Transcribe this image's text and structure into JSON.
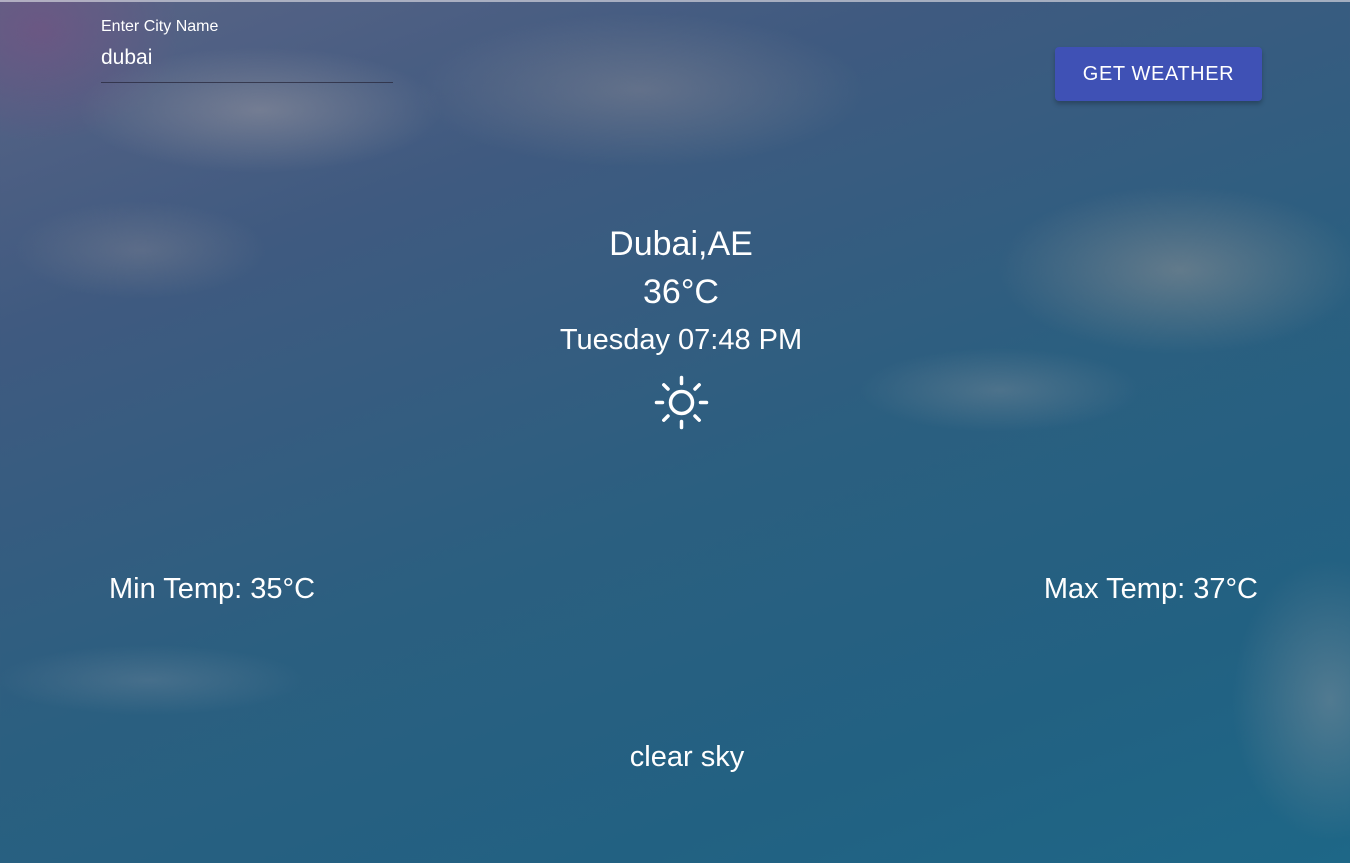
{
  "search": {
    "label": "Enter City Name",
    "value": "dubai"
  },
  "button": {
    "label": "GET WEATHER"
  },
  "weather": {
    "location": "Dubai,AE",
    "temperature": "36°C",
    "datetime": "Tuesday 07:48 PM",
    "icon": "sun-icon",
    "min_temp": "Min Temp: 35°C",
    "max_temp": "Max Temp: 37°C",
    "description": "clear sky"
  },
  "colors": {
    "button_bg": "#3f51b5",
    "text": "#ffffff"
  }
}
